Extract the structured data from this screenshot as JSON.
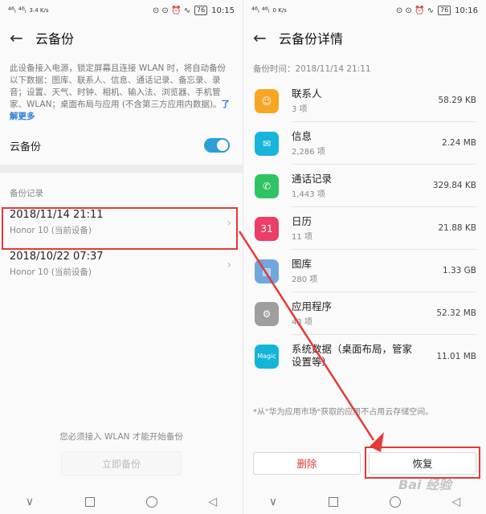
{
  "left": {
    "status": {
      "signal": "⁴⁶ₗ ⁴⁶ₗ",
      "speed": "3.4 K/s",
      "icons": "⊙ ⊙ ⏰ ∿",
      "battery": "76",
      "time": "10:15"
    },
    "title": "云备份",
    "description": "此设备接入电源，锁定屏幕且连接 WLAN 时，将自动备份以下数据：图库、联系人、信息、通话记录、备忘录、录音；设置、天气、时钟、相机、输入法、浏览器、手机管家、WLAN；桌面布局与应用 (不含第三方应用内数据)。",
    "learn_more": "了解更多",
    "toggle_label": "云备份",
    "records_label": "备份记录",
    "records": [
      {
        "date": "2018/11/14 21:11",
        "device": "Honor 10 (当前设备)"
      },
      {
        "date": "2018/10/22 07:37",
        "device": "Honor 10 (当前设备)"
      }
    ],
    "notice": "您必须接入 WLAN 才能开始备份",
    "backup_button": "立即备份"
  },
  "right": {
    "status": {
      "signal": "⁴⁶ₗ ⁴⁶ₗ",
      "speed": "0 K/s",
      "icons": "⊙ ⊙ ⏰ ∿",
      "battery": "76",
      "time": "10:16"
    },
    "title": "云备份详情",
    "backup_time": "备份时间：2018/11/14 21:11",
    "items": [
      {
        "name": "联系人",
        "count": "3 项",
        "size": "58.29 KB",
        "icon": "contacts-icon",
        "color": "#f6a623",
        "glyph": "☺"
      },
      {
        "name": "信息",
        "count": "2,286 项",
        "size": "2.24 MB",
        "icon": "messages-icon",
        "color": "#18b4dc",
        "glyph": "✉"
      },
      {
        "name": "通话记录",
        "count": "1,443 项",
        "size": "329.84 KB",
        "icon": "phone-icon",
        "color": "#2fc463",
        "glyph": "✆"
      },
      {
        "name": "日历",
        "count": "11 项",
        "size": "21.88 KB",
        "icon": "calendar-icon",
        "color": "#ec3e66",
        "glyph": "31"
      },
      {
        "name": "图库",
        "count": "280 项",
        "size": "1.33 GB",
        "icon": "gallery-icon",
        "color": "#6fa8dc",
        "glyph": "▨"
      },
      {
        "name": "应用程序",
        "count": "43 项",
        "size": "52.32 MB",
        "icon": "android-icon",
        "color": "#9e9e9e",
        "glyph": "⚙"
      },
      {
        "name": "系统数据（桌面布局，管家设置等）",
        "count": "",
        "size": "11.01 MB",
        "icon": "magic-icon",
        "color": "#12b5d8",
        "glyph": "Magic"
      }
    ],
    "footnote": "*从\"华为应用市场\"获取的应用不占用云存储空间。",
    "delete_button": "删除",
    "restore_button": "恢复"
  },
  "watermark": "Bai 经验",
  "colors": {
    "accent": "#2a9fd8",
    "highlight": "#e53935",
    "link": "#2a7ed6"
  }
}
